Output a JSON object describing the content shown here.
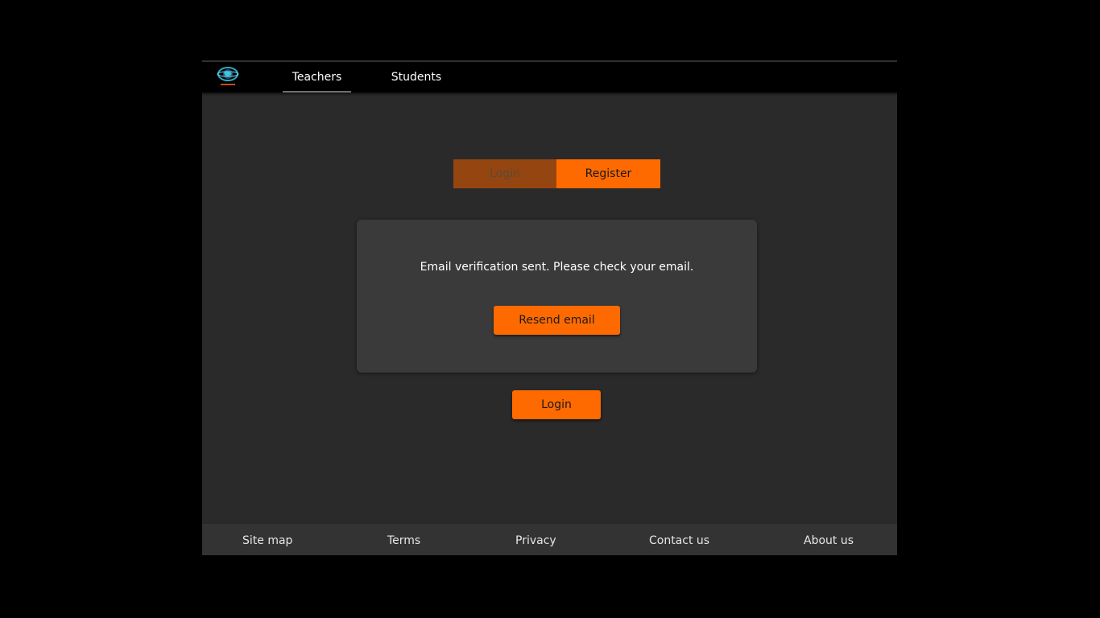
{
  "nav": {
    "logo_icon": "globe-logo-icon",
    "tabs": [
      {
        "label": "Teachers",
        "active": true
      },
      {
        "label": "Students",
        "active": false
      }
    ]
  },
  "auth_toggle": {
    "login_label": "Login",
    "register_label": "Register",
    "active": "Register"
  },
  "verification": {
    "message": "Email verification sent. Please check your email.",
    "resend_label": "Resend email"
  },
  "login_button_label": "Login",
  "footer": {
    "links": [
      "Site map",
      "Terms",
      "Privacy",
      "Contact us",
      "About us"
    ]
  },
  "colors": {
    "accent": "#ff6a00",
    "accent_dim": "#95450f",
    "background": "#2a2a2a",
    "topbar": "#000000",
    "card": "#3a3a3a",
    "footer": "#333333"
  }
}
